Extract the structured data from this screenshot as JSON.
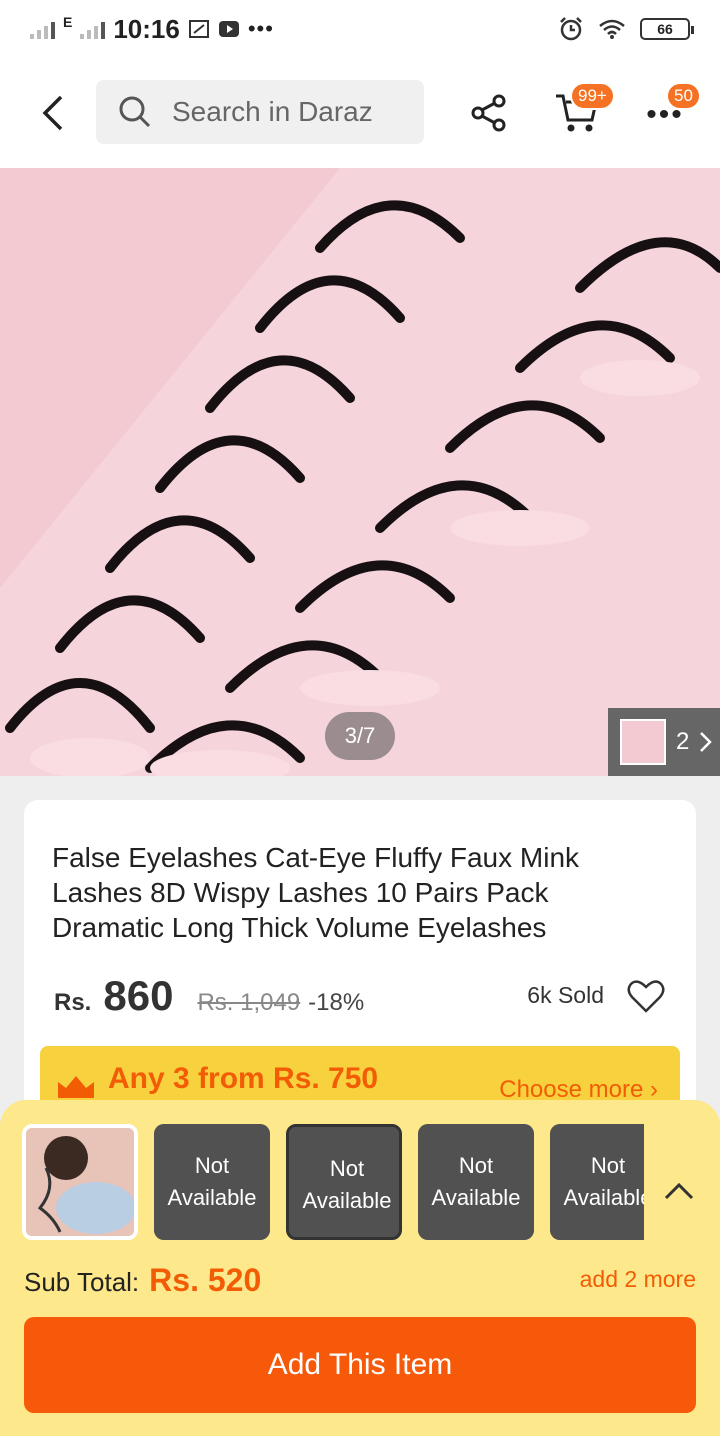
{
  "status_bar": {
    "network_label": "E",
    "time": "10:16",
    "battery": "66",
    "icons": [
      "signal-icon",
      "screenshot-icon",
      "youtube-icon",
      "more-dots-icon",
      "alarm-icon",
      "wifi-icon",
      "battery-icon"
    ]
  },
  "header": {
    "search_placeholder": "Search in Daraz",
    "cart_badge": "99+",
    "menu_badge": "50",
    "icons": [
      "back-arrow-icon",
      "search-icon",
      "share-icon",
      "cart-icon",
      "more-dots-icon"
    ]
  },
  "gallery": {
    "counter": "3/7",
    "thumb_count": "2"
  },
  "product": {
    "title": "False Eyelashes Cat-Eye Fluffy Faux Mink Lashes 8D Wispy Lashes 10 Pairs Pack Dramatic Long Thick Volume Eyelashes",
    "currency": "Rs.",
    "price": "860",
    "original_price": "Rs. 1,049",
    "discount": "-18%",
    "sold": "6k Sold"
  },
  "promo": {
    "text": "Any 3 from Rs. 750",
    "choose_more": "Choose more"
  },
  "bundle": {
    "items": [
      {
        "label": "",
        "selected": true
      },
      {
        "label": "Not Available",
        "selected": false
      },
      {
        "label": "Not Available",
        "selected": false
      },
      {
        "label": "Not Available",
        "selected": false
      },
      {
        "label": "Not Available",
        "selected": false
      }
    ],
    "subtotal_label": "Sub Total:",
    "subtotal_amount": "Rs. 520",
    "add_more": "add 2 more",
    "add_button": "Add This Item"
  },
  "colors": {
    "brand_orange": "#f6590a",
    "promo_yellow": "#f7d23e",
    "sheet_yellow": "#fde88b",
    "image_pink": "#f3c9d2"
  }
}
